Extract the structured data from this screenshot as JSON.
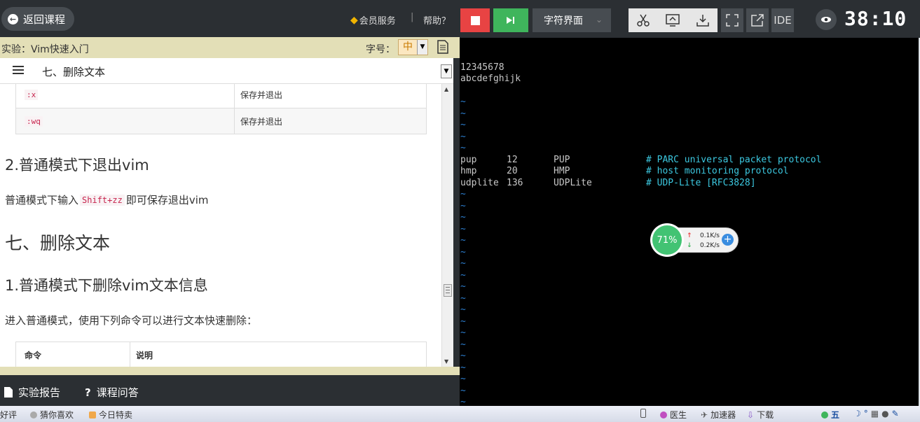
{
  "left": {
    "back_label": "返回课程",
    "vip_label": "会员服务",
    "separator": "|",
    "help_label": "帮助？",
    "lab_title": "实验：Vim快速入门",
    "font_size_label": "字号：",
    "font_size_value": "中",
    "section_select": "七、删除文本",
    "top_table": [
      {
        "cmd": ":x",
        "desc": "保存并退出"
      },
      {
        "cmd": ":wq",
        "desc": "保存并退出"
      }
    ],
    "heading_exit": "2.普通模式下退出vim",
    "para_exit_before": "普通模式下输入",
    "para_exit_code": "Shift+zz",
    "para_exit_after": "即可保存退出vim",
    "heading_delete": "七、删除文本",
    "heading_delete_sub": "1.普通模式下删除vim文本信息",
    "para_delete": "进入普通模式，使用下列命令可以进行文本快速删除：",
    "bottom_table_header": {
      "cmd": "命令",
      "desc": "说明"
    },
    "report_label": "实验报告",
    "qa_label": "课程问答"
  },
  "toolbar": {
    "mode_label": "字符界面",
    "ide_label": "IDE",
    "timer": "38:10"
  },
  "terminal": {
    "lines": [
      {
        "text": "12345678"
      },
      {
        "text": "abcdefghijk"
      }
    ],
    "services": [
      {
        "name": "pup",
        "port": "12",
        "alias": "PUP",
        "comment": "# PARC universal packet protocol"
      },
      {
        "name": "hmp",
        "port": "20",
        "alias": "HMP",
        "comment": "# host monitoring protocol"
      },
      {
        "name": "udplite",
        "port": "136",
        "alias": "UDPLite",
        "comment": "# UDP-Lite [RFC3828]"
      }
    ],
    "tilde": "~"
  },
  "net_widget": {
    "percent": "71%",
    "up_speed": "0.1K/s",
    "down_speed": "0.2K/s"
  },
  "taskbar": {
    "items": [
      "好评",
      "猜你喜欢",
      "今日特卖",
      "医生",
      "加速器",
      "下载",
      "五"
    ]
  },
  "colors": {
    "stop": "#e84343",
    "run": "#3fb55c",
    "tilde": "#2d7fd0",
    "comment": "#3cc8e0",
    "code": "#c7254e"
  }
}
